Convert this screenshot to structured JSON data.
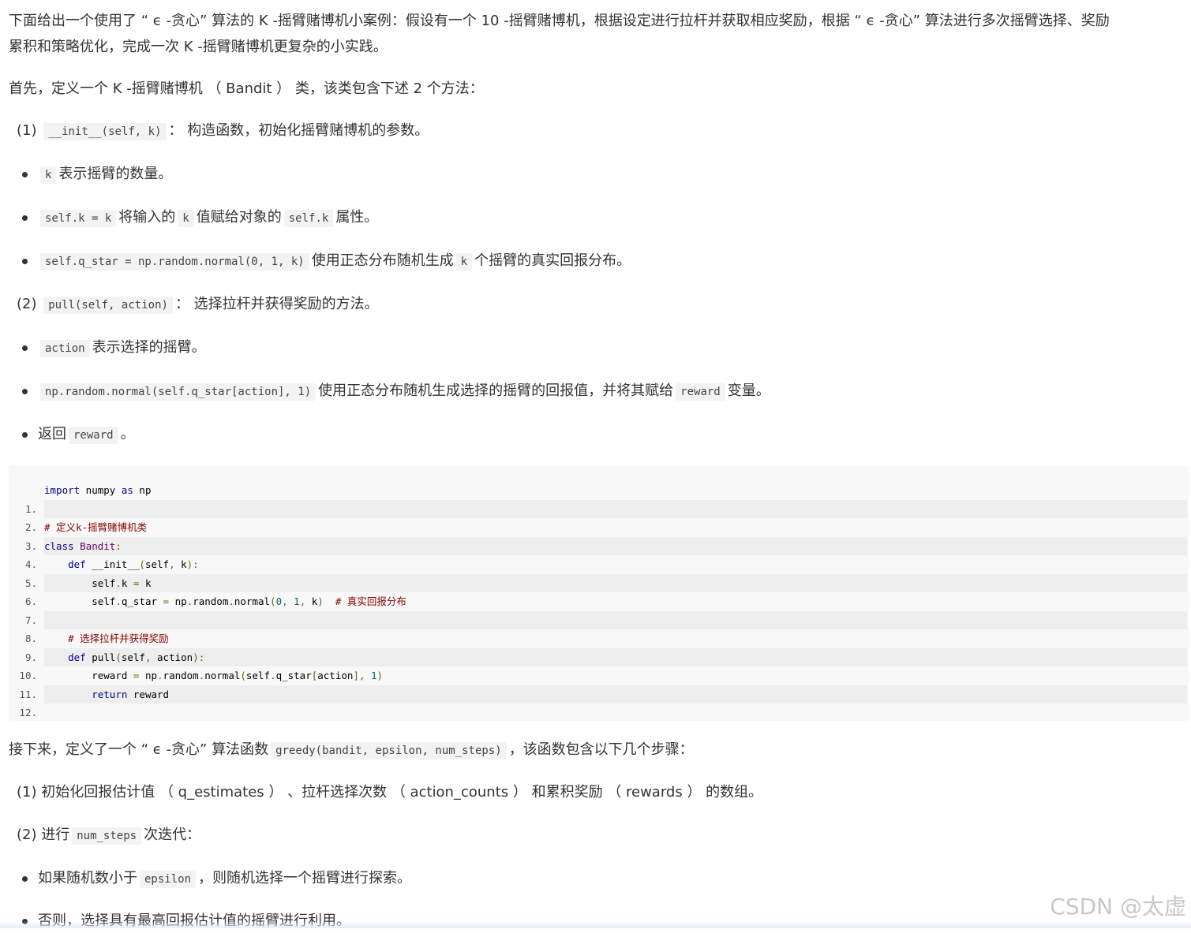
{
  "intro": {
    "line1": "下面给出一个使用了 “ ϵ -贪心” 算法的 K -摇臂赌博机小案例：假设有一个 10 -摇臂赌博机，根据设定进行拉杆并获取相应奖励，根据 “ ϵ -贪心” 算法进行多次摇臂选择、奖励",
    "line2": "累积和策略优化，完成一次 K -摇臂赌博机更复杂的小实践。"
  },
  "section1": {
    "text_a": "首先，定义一个 K -摇臂赌博机 （ Bandit ） 类，该类包含下述 2 个方法："
  },
  "method1": {
    "prefix": "(1) ",
    "code": "__init__(self, k)",
    "suffix": "： 构造函数，初始化摇臂赌博机的参数。",
    "bullets": [
      {
        "code": "k",
        "text": "表示摇臂的数量。"
      },
      {
        "code": "self.k = k",
        "text_a": "将输入的",
        "code2": "k",
        "text_b": "值赋给对象的",
        "code3": "self.k",
        "text_c": "属性。"
      },
      {
        "code": "self.q_star = np.random.normal(0, 1, k)",
        "text_a": "使用正态分布随机生成",
        "code2": "k",
        "text_b": "个摇臂的真实回报分布。"
      }
    ]
  },
  "method2": {
    "prefix": "(2) ",
    "code": "pull(self, action)",
    "suffix": "： 选择拉杆并获得奖励的方法。",
    "bullets": [
      {
        "code": "action",
        "text": "表示选择的摇臂。"
      },
      {
        "code": "np.random.normal(self.q_star[action], 1)",
        "text_a": "使用正态分布随机生成选择的摇臂的回报值，并将其赋给",
        "code2": "reward",
        "text_b": "变量。"
      },
      {
        "text_a": "返回",
        "code": "reward",
        "text_b": "。"
      }
    ]
  },
  "code_block": {
    "line_numbers": [
      "1.",
      "2.",
      "3.",
      "4.",
      "5.",
      "6.",
      "7.",
      "8.",
      "9.",
      "10.",
      "11.",
      "12."
    ],
    "l1": {
      "kw": "import",
      "t1": " numpy ",
      "kw2": "as",
      "t2": " np"
    },
    "l3": {
      "cm": "# 定义k-摇臂赌博机类"
    },
    "l4": {
      "kw": "class",
      "sp": " ",
      "ty": "Bandit",
      "pu": ":"
    },
    "l5": {
      "indent": "    ",
      "kw": "def",
      "t1": " __init__",
      "p1": "(",
      "t2": "self",
      "p2": ",",
      "t3": " k",
      "p3": "):"
    },
    "l6": {
      "indent": "        ",
      "t1": "self",
      "p1": ".",
      "t2": "k ",
      "p2": "=",
      "t3": " k"
    },
    "l7": {
      "indent": "        ",
      "t1": "self",
      "p1": ".",
      "t2": "q_star ",
      "p2": "=",
      "t3": " np",
      "p3": ".",
      "t4": "random",
      "p4": ".",
      "t5": "normal",
      "p5": "(",
      "n1": "0",
      "p6": ",",
      "sp1": " ",
      "n2": "1",
      "p7": ",",
      "t6": " k",
      "p8": ")",
      "sp2": "  ",
      "cm": "# 真实回报分布"
    },
    "l9": {
      "indent": "    ",
      "cm": "# 选择拉杆并获得奖励"
    },
    "l10": {
      "indent": "    ",
      "kw": "def",
      "t1": " pull",
      "p1": "(",
      "t2": "self",
      "p2": ",",
      "t3": " action",
      "p3": "):"
    },
    "l11": {
      "indent": "        ",
      "t1": "reward ",
      "p1": "=",
      "t2": " np",
      "p2": ".",
      "t3": "random",
      "p3": ".",
      "t4": "normal",
      "p4": "(",
      "t5": "self",
      "p5": ".",
      "t6": "q_star",
      "p6": "[",
      "t7": "action",
      "p7": "],",
      "sp": " ",
      "n1": "1",
      "p8": ")"
    },
    "l12": {
      "indent": "        ",
      "kw": "return",
      "t1": " reward"
    }
  },
  "section2": {
    "text_a": "接下来，定义了一个 “ ϵ -贪心” 算法函数",
    "code": "greedy(bandit, epsilon, num_steps)",
    "text_b": "，该函数包含以下几个步骤："
  },
  "steps": {
    "s1": "(1) 初始化回报估计值 （ q_estimates ） 、拉杆选择次数 （ action_counts ） 和累积奖励 （ rewards ） 的数组。",
    "s2_prefix": "(2) 进行",
    "s2_code": "num_steps",
    "s2_suffix": "次迭代：",
    "b1_a": "如果随机数小于",
    "b1_code": "epsilon",
    "b1_b": "，则随机选择一个摇臂进行探索。",
    "b2": "否则，选择具有最高回报估计值的摇臂进行利用。"
  },
  "watermark": "CSDN @太虚"
}
